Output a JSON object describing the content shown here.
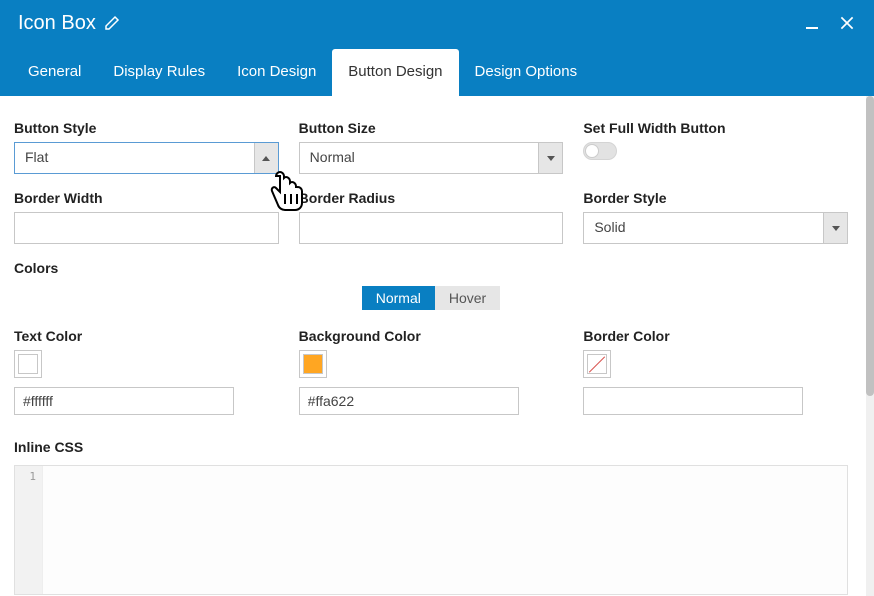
{
  "header": {
    "title": "Icon Box"
  },
  "tabs": [
    {
      "label": "General",
      "active": false
    },
    {
      "label": "Display Rules",
      "active": false
    },
    {
      "label": "Icon Design",
      "active": false
    },
    {
      "label": "Button Design",
      "active": true
    },
    {
      "label": "Design Options",
      "active": false
    }
  ],
  "fields": {
    "button_style": {
      "label": "Button Style",
      "value": "Flat"
    },
    "button_size": {
      "label": "Button Size",
      "value": "Normal"
    },
    "full_width": {
      "label": "Set Full Width Button",
      "on": false
    },
    "border_width": {
      "label": "Border Width",
      "value": ""
    },
    "border_radius": {
      "label": "Border Radius",
      "value": ""
    },
    "border_style": {
      "label": "Border Style",
      "value": "Solid"
    },
    "colors_label": "Colors",
    "state_tabs": {
      "normal": "Normal",
      "hover": "Hover",
      "active": "normal"
    },
    "text_color": {
      "label": "Text Color",
      "value": "#ffffff"
    },
    "bg_color": {
      "label": "Background Color",
      "value": "#ffa622"
    },
    "border_color": {
      "label": "Border Color",
      "value": ""
    },
    "inline_css": {
      "label": "Inline CSS",
      "line": "1"
    }
  }
}
